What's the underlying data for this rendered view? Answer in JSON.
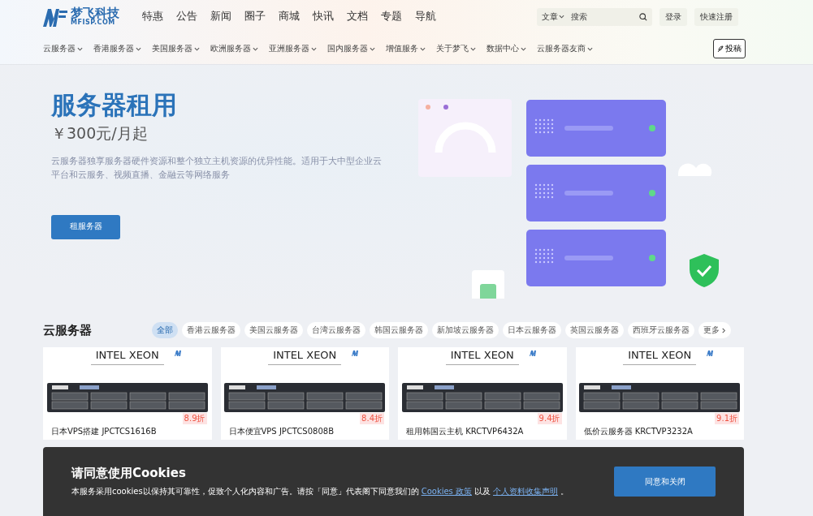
{
  "logo": {
    "name": "梦飞科技",
    "domain": "MFISP.COM"
  },
  "top_nav": [
    "特惠",
    "公告",
    "新闻",
    "圈子",
    "商城",
    "快讯",
    "文档",
    "专题",
    "导航"
  ],
  "search": {
    "scope": "文章",
    "placeholder": "搜索"
  },
  "account_buttons": [
    "登录",
    "快速注册"
  ],
  "sub_nav": [
    "云服务器",
    "香港服务器",
    "美国服务器",
    "欧洲服务器",
    "亚洲服务器",
    "国内服务器",
    "增值服务",
    "关于梦飞",
    "数据中心",
    "云服务器友商"
  ],
  "post_button": "投稿",
  "hero": {
    "title": "服务器租用",
    "price": "￥300元/月起",
    "description": "云服务器独享服务器硬件资源和整个独立主机资源的优异性能。适用于大中型企业云平台和云服务、视频直播、金融云等网络服务",
    "button": "租服务器"
  },
  "section": {
    "title": "云服务器",
    "filters": [
      {
        "label": "全部",
        "selected": true
      },
      {
        "label": "香港云服务器",
        "selected": false
      },
      {
        "label": "美国云服务器",
        "selected": false
      },
      {
        "label": "台湾云服务器",
        "selected": false
      },
      {
        "label": "韩国云服务器",
        "selected": false
      },
      {
        "label": "新加坡云服务器",
        "selected": false
      },
      {
        "label": "日本云服务器",
        "selected": false
      },
      {
        "label": "英国云服务器",
        "selected": false
      },
      {
        "label": "西班牙云服务器",
        "selected": false
      }
    ],
    "more": "更多",
    "cards": [
      {
        "banner": "INTEL XEON",
        "discount": "8.9折",
        "title": "日本VPS搭建 JPCTCS1616B"
      },
      {
        "banner": "INTEL XEON",
        "discount": "8.4折",
        "title": "日本便宜VPS JPCTCS0808B"
      },
      {
        "banner": "INTEL XEON",
        "discount": "9.4折",
        "title": "租用韩国云主机 KRCTVP6432A"
      },
      {
        "banner": "INTEL XEON",
        "discount": "9.1折",
        "title": "低价云服务器 KRCTVP3232A"
      }
    ]
  },
  "cookie_banner": {
    "title": "请同意使用Cookies",
    "text_before": "本服务采用cookies以保持其可靠性，促致个人化内容和广告。请按「同意」代表阁下同意我们的",
    "policy_link": "Cookies 政策",
    "text_middle": "以及",
    "statement_link": "个人资料收集声明",
    "text_after": "。",
    "button": "同意和关闭"
  }
}
